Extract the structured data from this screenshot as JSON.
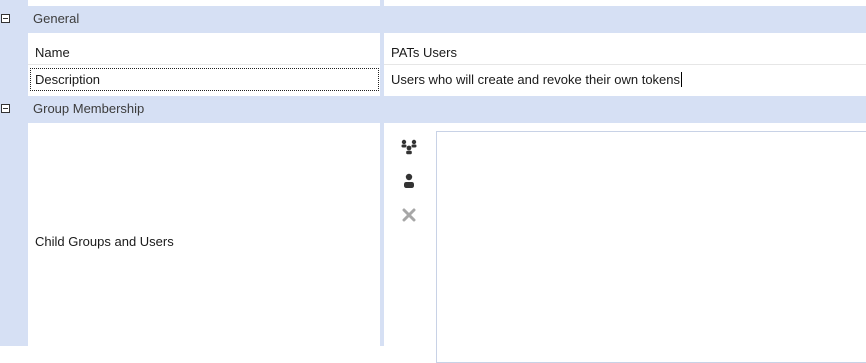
{
  "categories": {
    "general": {
      "label": "General"
    },
    "group_membership": {
      "label": "Group Membership"
    }
  },
  "properties": {
    "name": {
      "label": "Name",
      "value": "PATs Users"
    },
    "description": {
      "label": "Description",
      "value": "Users who will create and revoke their own tokens"
    },
    "child_groups": {
      "label": "Child Groups and Users"
    }
  },
  "icons": {
    "add_group": "add-group-icon",
    "add_user": "add-user-icon",
    "remove": "remove-icon"
  },
  "colors": {
    "category_band": "#d6e0f4",
    "listbox_border": "#c8d2e6",
    "remove_icon": "#a7a7a7"
  }
}
